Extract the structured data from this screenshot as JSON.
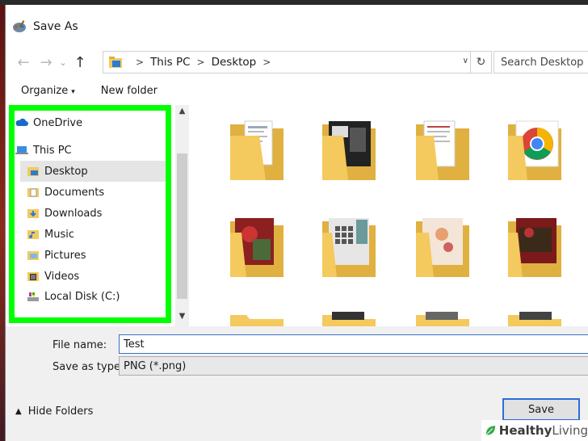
{
  "window": {
    "title": "Save As"
  },
  "nav": {
    "breadcrumbs": [
      "This PC",
      "Desktop"
    ],
    "search_placeholder": "Search Desktop"
  },
  "toolbar": {
    "organize_label": "Organize",
    "new_folder_label": "New folder"
  },
  "sidebar": {
    "items": [
      {
        "label": "OneDrive",
        "icon": "cloud-icon"
      },
      {
        "label": "This PC",
        "icon": "computer-icon"
      },
      {
        "label": "Desktop",
        "icon": "desktop-folder-icon",
        "selected": true
      },
      {
        "label": "Documents",
        "icon": "documents-icon"
      },
      {
        "label": "Downloads",
        "icon": "downloads-icon"
      },
      {
        "label": "Music",
        "icon": "music-icon"
      },
      {
        "label": "Pictures",
        "icon": "pictures-icon"
      },
      {
        "label": "Videos",
        "icon": "videos-icon"
      },
      {
        "label": "Local Disk (C:)",
        "icon": "disk-icon"
      }
    ],
    "highlight_color": "#00ff00"
  },
  "content": {
    "folders": [
      {
        "thumb": "document"
      },
      {
        "thumb": "dark-screenshot"
      },
      {
        "thumb": "document"
      },
      {
        "thumb": "chrome"
      },
      {
        "thumb": "red-photo"
      },
      {
        "thumb": "keyboard-photo"
      },
      {
        "thumb": "light-photo"
      },
      {
        "thumb": "red-photo-2"
      },
      {
        "thumb": "plain"
      },
      {
        "thumb": "plain"
      },
      {
        "thumb": "plain"
      },
      {
        "thumb": "plain"
      }
    ]
  },
  "form": {
    "file_name_label": "File name:",
    "file_name_value": "Test",
    "save_type_label": "Save as type:",
    "save_type_value": "PNG (*.png)",
    "hide_folders_label": "Hide Folders",
    "save_label": "Save"
  },
  "watermark": {
    "text_bold": "Healthy",
    "text": " Living"
  },
  "colors": {
    "accent": "#2b6ed8",
    "folder": "#f4c95d",
    "selection": "#e5e5e5"
  }
}
